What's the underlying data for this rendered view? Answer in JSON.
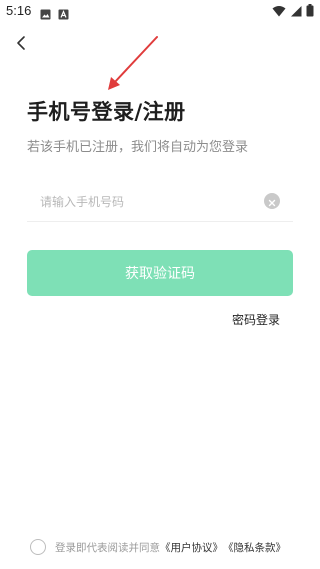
{
  "status_bar": {
    "time": "5:16",
    "left_icons": [
      "gallery-icon",
      "font-a-icon"
    ],
    "right_icons": [
      "wifi-icon",
      "signal-icon",
      "battery-icon"
    ]
  },
  "header": {
    "back_icon": "chevron-left-icon"
  },
  "login": {
    "title": "手机号登录/注册",
    "subtitle": "若该手机已注册，我们将自动为您登录",
    "phone_placeholder": "请输入手机号码",
    "phone_value": "",
    "clear_icon": "clear-circle-icon",
    "get_code_label": "获取验证码",
    "password_login_label": "密码登录"
  },
  "agreement": {
    "prefix": "登录即代表阅读并同意",
    "user_agreement": "《用户协议》",
    "privacy_policy": "《隐私条款》",
    "checked": false
  },
  "colors": {
    "primary_button": "#7ee0b6",
    "annotation_arrow": "#e03c3c",
    "title": "#1e1e1e",
    "subtitle": "#8c8c8c"
  }
}
